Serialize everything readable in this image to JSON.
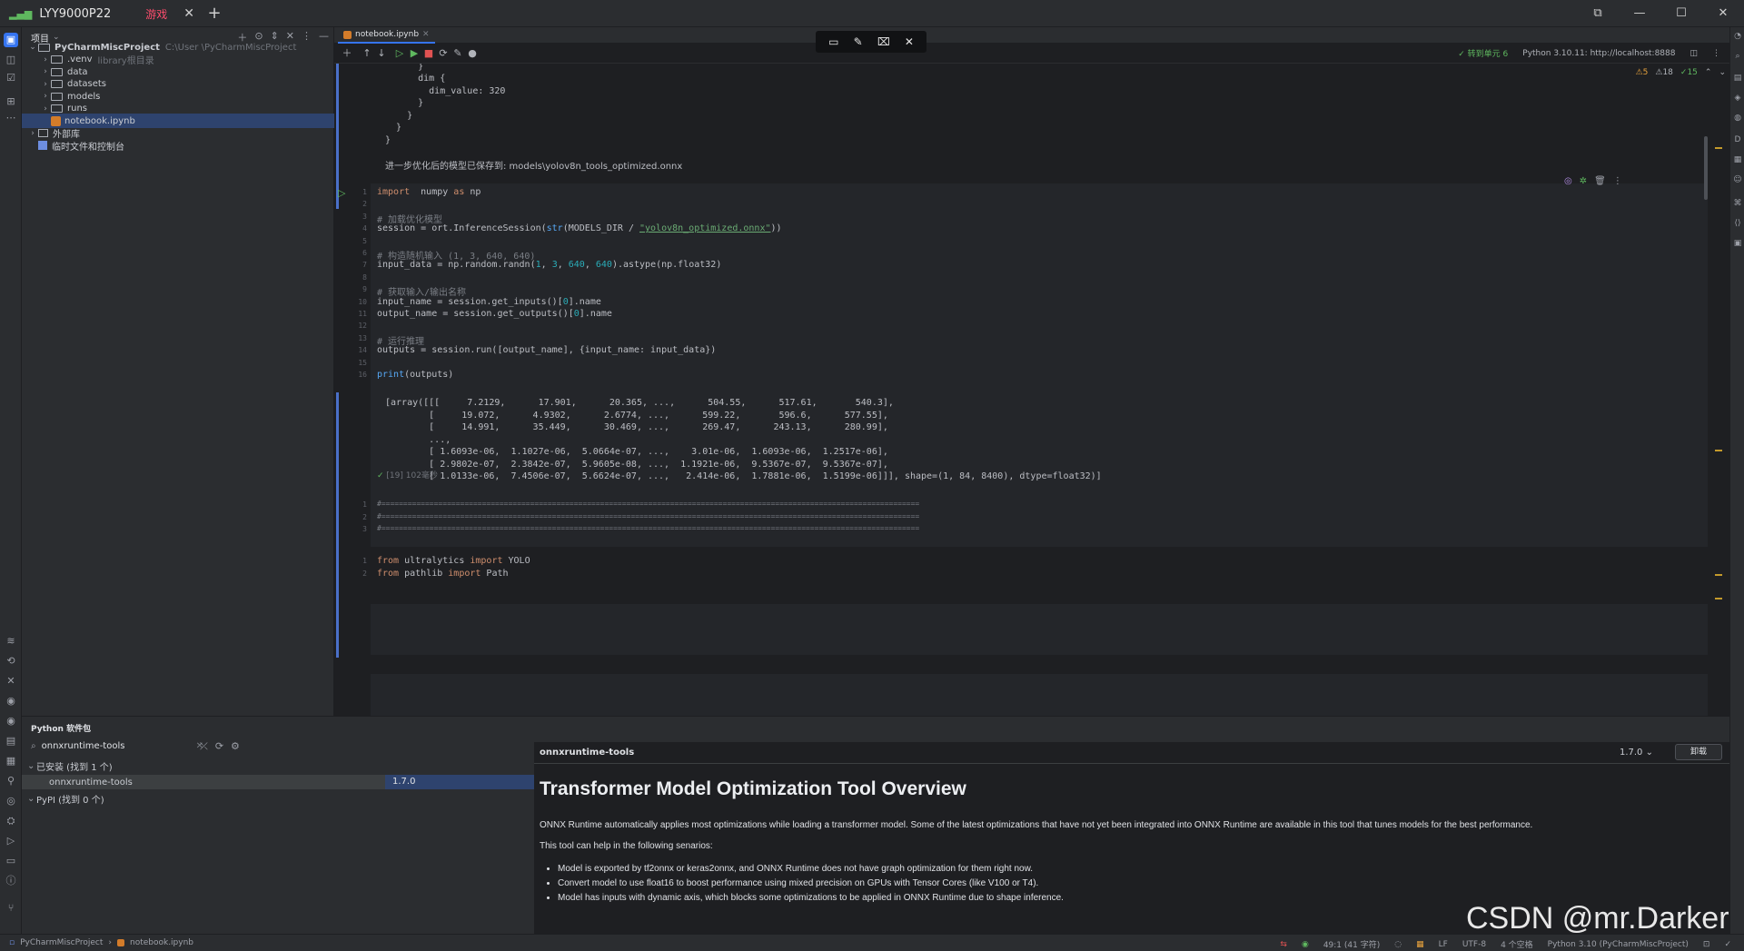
{
  "window": {
    "tab_title": "LYY9000P22",
    "tab_badge": "游戏",
    "close_glyph": "✕",
    "new_tab_glyph": "+",
    "controls": {
      "restore_small": "⧉",
      "minimize": "—",
      "maximize": "☐",
      "close": "✕"
    }
  },
  "floating_toolbar": {
    "icons": [
      "screen-icon",
      "pen-icon",
      "clip-icon",
      "close-circle-icon"
    ],
    "glyphs": [
      "▭",
      "✎",
      "⌧",
      "✕"
    ]
  },
  "project_panel": {
    "title": "项目",
    "items": [
      {
        "label": "PyCharmMiscProject",
        "hint": "C:\\User            \\PyCharmMiscProject",
        "depth": 0,
        "type": "folder",
        "expanded": true
      },
      {
        "label": ".venv",
        "hint": "library根目录",
        "depth": 1,
        "type": "folder"
      },
      {
        "label": "data",
        "hint": "",
        "depth": 1,
        "type": "folder"
      },
      {
        "label": "datasets",
        "hint": "",
        "depth": 1,
        "type": "folder"
      },
      {
        "label": "models",
        "hint": "",
        "depth": 1,
        "type": "folder"
      },
      {
        "label": "runs",
        "hint": "",
        "depth": 1,
        "type": "folder"
      },
      {
        "label": "notebook.ipynb",
        "hint": "",
        "depth": 1,
        "type": "notebook",
        "selected": true
      },
      {
        "label": "外部库",
        "hint": "",
        "depth": 0,
        "type": "lib"
      },
      {
        "label": "临时文件和控制台",
        "hint": "",
        "depth": 0,
        "type": "scratch"
      }
    ]
  },
  "editor": {
    "tab": "notebook.ipynb",
    "kernel_status": "✓ 转到单元 6",
    "kernel": "Python 3.10.11: http://localhost:8888",
    "inspections": {
      "warnings": "⚠5",
      "weak": "⚠18",
      "ok": "✓15"
    },
    "prev_output": [
      "        dim_value: 320",
      "      }",
      "      dim {",
      "        dim_value: 320",
      "      }",
      "    }",
      "  }",
      "}"
    ],
    "saved_msg": "进一步优化后的模型已保存到: models\\yolov8n_tools_optimized.onnx",
    "cell": {
      "line_numbers": [
        "1",
        "2",
        "3",
        "4",
        "5",
        "6",
        "7",
        "8",
        "9",
        "10",
        "11",
        "12",
        "13",
        "14",
        "15",
        "16"
      ],
      "lines": [
        {
          "t": "code",
          "parts": [
            [
              "kw",
              "import"
            ],
            [
              "",
              "  numpy "
            ],
            [
              "kw",
              "as"
            ],
            [
              "",
              " np"
            ]
          ]
        },
        {
          "t": "blank"
        },
        {
          "t": "code",
          "parts": [
            [
              "cm",
              "# 加载优化模型"
            ]
          ]
        },
        {
          "t": "code",
          "parts": [
            [
              "",
              "session = ort.InferenceSession("
            ],
            [
              "fn",
              "str"
            ],
            [
              "",
              "(MODELS_DIR / "
            ],
            [
              "str",
              "\"yolov8n_optimized.onnx\""
            ],
            [
              "",
              "))"
            ]
          ]
        },
        {
          "t": "blank"
        },
        {
          "t": "code",
          "parts": [
            [
              "cm",
              "# 构造随机输入 (1, 3, 640, 640)"
            ]
          ]
        },
        {
          "t": "code",
          "parts": [
            [
              "",
              "input_data = np.random.randn("
            ],
            [
              "num",
              "1"
            ],
            [
              "",
              ", "
            ],
            [
              "num",
              "3"
            ],
            [
              "",
              ", "
            ],
            [
              "num",
              "640"
            ],
            [
              "",
              ", "
            ],
            [
              "num",
              "640"
            ],
            [
              "",
              ").astype(np.float32)"
            ]
          ]
        },
        {
          "t": "blank"
        },
        {
          "t": "code",
          "parts": [
            [
              "cm",
              "# 获取输入/输出名称"
            ]
          ]
        },
        {
          "t": "code",
          "parts": [
            [
              "",
              "input_name = session.get_inputs()["
            ],
            [
              "num",
              "0"
            ],
            [
              "",
              "].name"
            ]
          ]
        },
        {
          "t": "code",
          "parts": [
            [
              "",
              "output_name = session.get_outputs()["
            ],
            [
              "num",
              "0"
            ],
            [
              "",
              "].name"
            ]
          ]
        },
        {
          "t": "blank"
        },
        {
          "t": "code",
          "parts": [
            [
              "cm",
              "# 运行推理"
            ]
          ]
        },
        {
          "t": "code",
          "parts": [
            [
              "",
              "outputs = session.run([output_name], {input_name: input_data})"
            ]
          ]
        },
        {
          "t": "blank"
        },
        {
          "t": "code",
          "parts": [
            [
              "fn",
              "print"
            ],
            [
              "",
              "(outputs)"
            ]
          ]
        }
      ],
      "exec_info": "[19] 102毫秒"
    },
    "output": [
      "[array([[[     7.2129,      17.901,      20.365, ...,      504.55,      517.61,       540.3],",
      "        [     19.072,      4.9302,      2.6774, ...,      599.22,       596.6,      577.55],",
      "        [     14.991,      35.449,      30.469, ...,      269.47,      243.13,      280.99],",
      "        ...,",
      "        [ 1.6093e-06,  1.1027e-06,  5.0664e-07, ...,    3.01e-06,  1.6093e-06,  1.2517e-06],",
      "        [ 2.9802e-07,  2.3842e-07,  5.9605e-08, ...,  1.1921e-06,  9.5367e-07,  9.5367e-07],",
      "        [ 1.0133e-06,  7.4506e-07,  5.6624e-07, ...,   2.414e-06,  1.7881e-06,  1.5199e-06]]], shape=(1, 84, 8400), dtype=float32)]"
    ],
    "comment_cell": [
      "#===========================================================================================================================",
      "#===========================================================================================================================",
      "#==========================================================================================================================="
    ],
    "next_cell": [
      {
        "parts": [
          [
            "kw",
            "from"
          ],
          [
            "",
            " ultralytics "
          ],
          [
            "kw",
            "import"
          ],
          [
            "",
            " YOLO"
          ]
        ]
      },
      {
        "parts": [
          [
            "kw",
            "from"
          ],
          [
            "",
            " pathlib "
          ],
          [
            "kw",
            "import"
          ],
          [
            "",
            " Path"
          ]
        ]
      }
    ]
  },
  "packages": {
    "title": "Python 软件包",
    "search_value": "onnxruntime-tools",
    "installed_group": "已安装 (找到 1 个)",
    "installed_pkg": "onnxruntime-tools",
    "installed_ver": "1.7.0",
    "pypi_group": "PyPI (找到 0 个)",
    "detail": {
      "name": "onnxruntime-tools",
      "version": "1.7.0",
      "uninstall": "卸载",
      "doc_title": "Transformer Model Optimization Tool Overview",
      "para1": "ONNX Runtime automatically applies most optimizations while loading a transformer model. Some of the latest optimizations that have not yet been integrated into ONNX Runtime are available in this tool that tunes models for the best performance.",
      "para2": "This tool can help in the following senarios:",
      "bullets": [
        "Model is exported by tf2onnx or keras2onnx, and ONNX Runtime does not have graph optimization for them right now.",
        "Convert model to use float16 to boost performance using mixed precision on GPUs with Tensor Cores (like V100 or T4).",
        "Model has inputs with dynamic axis, which blocks some optimizations to be applied in ONNX Runtime due to shape inference."
      ]
    }
  },
  "watermark": "CSDN @mr.Darker",
  "statusbar": {
    "crumb1": "PyCharmMiscProject",
    "crumb2": "notebook.ipynb",
    "position": "49:1 (41 字符)",
    "line_sep": "LF",
    "encoding": "UTF-8",
    "indent": "4 个空格",
    "interpreter": "Python 3.10 (PyCharmMiscProject)"
  },
  "colors": {
    "accent": "#3574f0",
    "selection": "#2e436e",
    "ok": "#5fb85f",
    "warning": "#e8a33d"
  }
}
